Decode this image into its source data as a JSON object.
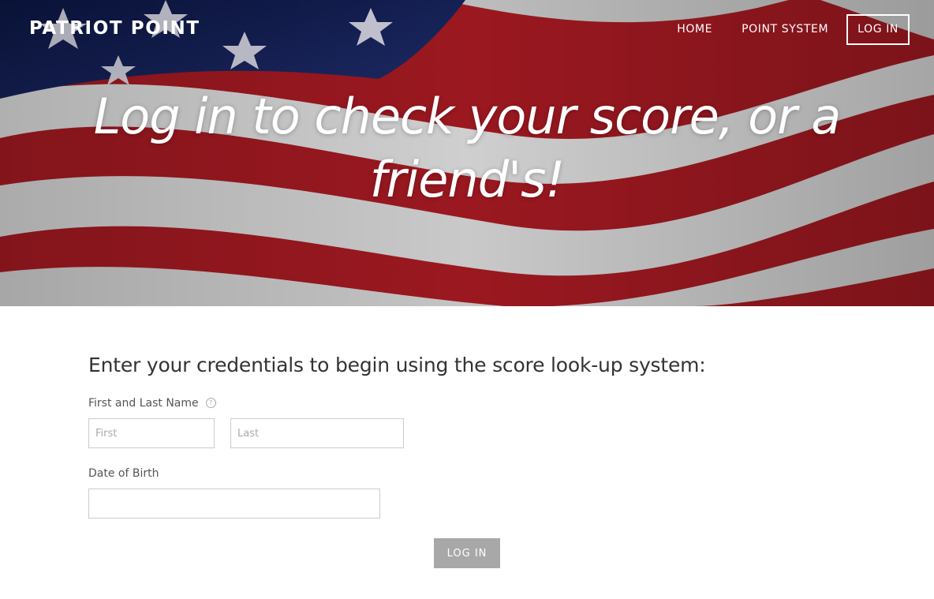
{
  "header": {
    "brand": "PATRIOT POINT",
    "nav": {
      "home": "HOME",
      "point_system": "POINT SYSTEM",
      "login": "LOG IN"
    }
  },
  "hero": {
    "line1": "Log in to check your score, or a",
    "line2": "friend's!"
  },
  "form": {
    "heading": "Enter your credentials to begin using the score look-up system:",
    "name_label": "First and Last Name",
    "help_glyph": "?",
    "first_placeholder": "First",
    "last_placeholder": "Last",
    "dob_label": "Date of Birth",
    "dob_value": "",
    "submit_label": "LOG IN"
  },
  "colors": {
    "flag_red": "#a3131c",
    "flag_blue": "#0f1a4a",
    "button_gray": "#a8a8a8"
  }
}
